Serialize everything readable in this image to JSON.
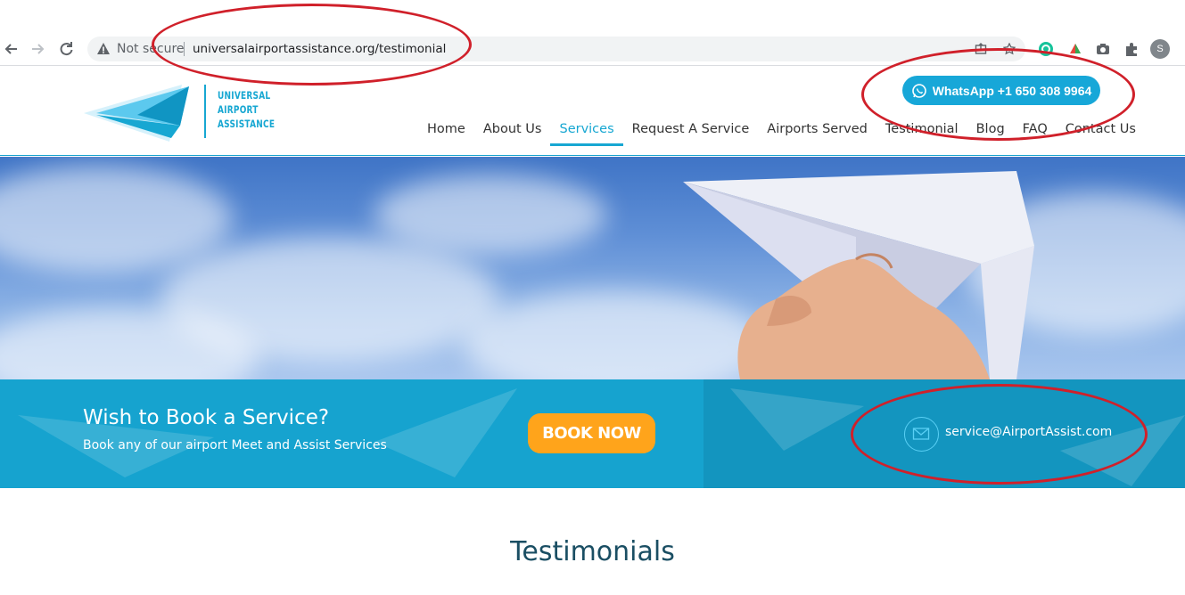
{
  "browser": {
    "not_secure_label": "Not secure",
    "url": "universalairportassistance.org/testimonial",
    "profile_initial": "S",
    "icons": [
      "back-icon",
      "forward-icon",
      "reload-icon",
      "warning-icon",
      "share-icon",
      "star-icon",
      "grammarly-icon",
      "extension-colored-icon",
      "camera-icon",
      "puzzle-icon"
    ]
  },
  "header": {
    "logo_lines": [
      "UNIVERSAL",
      "AIRPORT",
      "ASSISTANCE"
    ],
    "whatsapp_label": "WhatsApp +1 650 308 9964",
    "nav": [
      "Home",
      "About Us",
      "Services",
      "Request A Service",
      "Airports Served",
      "Testimonial",
      "Blog",
      "FAQ",
      "Contact Us"
    ],
    "active_nav": "Services"
  },
  "band": {
    "title": "Wish to Book a Service?",
    "subtitle": "Book any of our airport Meet and Assist Services",
    "book_label": "BOOK NOW",
    "email": "service@AirportAssist.com"
  },
  "section": {
    "title": "Testimonials"
  },
  "colors": {
    "brand_blue": "#17a7d2",
    "book_orange": "#ffa41b",
    "annotation_red": "#d0202a"
  }
}
